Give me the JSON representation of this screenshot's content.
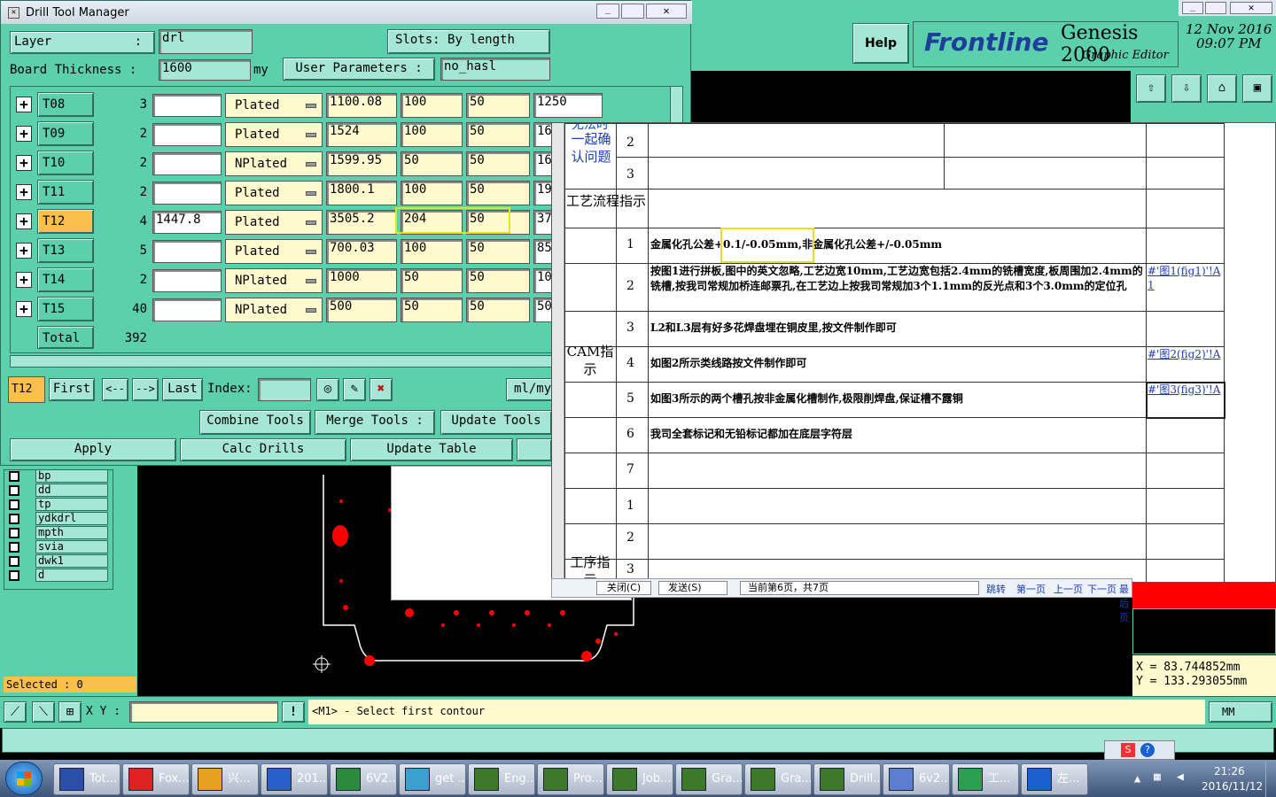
{
  "drill_window": {
    "title": "Drill Tool Manager",
    "layer_label": "Layer",
    "layer_colon": ":",
    "layer_value": "drl",
    "slots_label": "Slots:",
    "slots_value": "By length",
    "board_thickness_label": "Board Thickness :",
    "board_thickness_value": "1600",
    "board_thickness_unit": "my",
    "user_params_label": "User Parameters :",
    "user_params_value": "no_hasl",
    "rows": [
      {
        "tool": "T08",
        "count": "3",
        "finish": "",
        "type": "Plated",
        "drill": "1100.08",
        "tol1": "100",
        "tol2": "50",
        "extra": "1250"
      },
      {
        "tool": "T09",
        "count": "2",
        "finish": "",
        "type": "Plated",
        "drill": "1524",
        "tol1": "100",
        "tol2": "50",
        "extra": "16"
      },
      {
        "tool": "T10",
        "count": "2",
        "finish": "",
        "type": "NPlated",
        "drill": "1599.95",
        "tol1": "50",
        "tol2": "50",
        "extra": "16"
      },
      {
        "tool": "T11",
        "count": "2",
        "finish": "",
        "type": "Plated",
        "drill": "1800.1",
        "tol1": "100",
        "tol2": "50",
        "extra": "19"
      },
      {
        "tool": "T12",
        "count": "4",
        "finish": "1447.8",
        "type": "Plated",
        "drill": "3505.2",
        "tol1": "204",
        "tol2": "50",
        "extra": "37"
      },
      {
        "tool": "T13",
        "count": "5",
        "finish": "",
        "type": "Plated",
        "drill": "700.03",
        "tol1": "100",
        "tol2": "50",
        "extra": "85"
      },
      {
        "tool": "T14",
        "count": "2",
        "finish": "",
        "type": "NPlated",
        "drill": "1000",
        "tol1": "50",
        "tol2": "50",
        "extra": "10"
      },
      {
        "tool": "T15",
        "count": "40",
        "finish": "",
        "type": "NPlated",
        "drill": "500",
        "tol1": "50",
        "tol2": "50",
        "extra": "50"
      }
    ],
    "total_label": "Total",
    "total_value": "392",
    "current_tool": "T12",
    "nav": {
      "first": "First",
      "prev": "<--",
      "next": "-->",
      "last": "Last",
      "index_label": "Index:",
      "units": "ml/my"
    },
    "combine_tools": "Combine Tools",
    "merge_tools": "Merge Tools :",
    "update_tools": "Update Tools",
    "apply": "Apply",
    "calc_drills": "Calc Drills",
    "update_table": "Update Table"
  },
  "genesis": {
    "help": "Help",
    "brand": "Frontline",
    "product": "Genesis 2000",
    "subtitle": "Graphic Editor",
    "date": "12 Nov 2016",
    "time": "09:07 PM",
    "layers": [
      "bp",
      "dd",
      "tp",
      "ydkdrl",
      "mpth",
      "svia",
      "dwk1",
      "d"
    ],
    "selected_label": "Selected : 0",
    "xy_label": "X Y :",
    "prompt": "<M1> - Select first contour",
    "units": "MM",
    "coord_x": "X  =  83.744852mm",
    "coord_y": "Y  =  133.293055mm"
  },
  "sheet": {
    "top_header": "一起确认问题",
    "top_header_partial": "无法时",
    "process_header": "工艺流程指示",
    "cam_header": "CAM指示",
    "seq_header": "工序指示",
    "rows_top": [
      "2",
      "3"
    ],
    "cam_rows": [
      {
        "n": "1",
        "text": "金属化孔公差+0.1/-0.05mm,非金属化孔公差+/-0.05mm",
        "link": ""
      },
      {
        "n": "2",
        "text": "按图1进行拼板,图中的英文忽略,工艺边宽10mm,工艺边宽包括2.4mm的铣槽宽度,板周围加2.4mm的铣槽,按我司常规加桥连邮票孔,在工艺边上按我司常规加3个1.1mm的反光点和3个3.0mm的定位孔",
        "link": "#'图1(fig1)'!A1"
      },
      {
        "n": "3",
        "text": "L2和L3层有好多花焊盘埋在铜皮里,按文件制作即可",
        "link": ""
      },
      {
        "n": "4",
        "text": "如图2所示类线路按文件制作即可",
        "link": "#'图2(fig2)'!A"
      },
      {
        "n": "5",
        "text": "如图3所示的两个槽孔按非金属化槽制作,极限削焊盘,保证槽不露铜",
        "link": "#'图3(fig3)'!A"
      },
      {
        "n": "6",
        "text": "我司全套标记和无铅标记都加在底层字符层",
        "link": ""
      },
      {
        "n": "7",
        "text": "",
        "link": ""
      }
    ],
    "seq_rows": [
      "1",
      "2",
      "3"
    ],
    "footer": {
      "close": "关闭(C)",
      "send": "发送(S)",
      "page_info": "当前第6页，共7页",
      "jump": "跳转",
      "first": "第一页",
      "prev": "上一页",
      "next": "下一页",
      "last": "最后页"
    }
  },
  "taskbar": {
    "items": [
      "Tot...",
      "Fox...",
      "兴...",
      "201...",
      "6V2...",
      "get ...",
      "Eng...",
      "Pro...",
      "Job...",
      "Gra...",
      "Gra...",
      "Drill...",
      "6v2...",
      "工...",
      "左..."
    ],
    "time": "21:26",
    "date": "2016/11/12"
  }
}
